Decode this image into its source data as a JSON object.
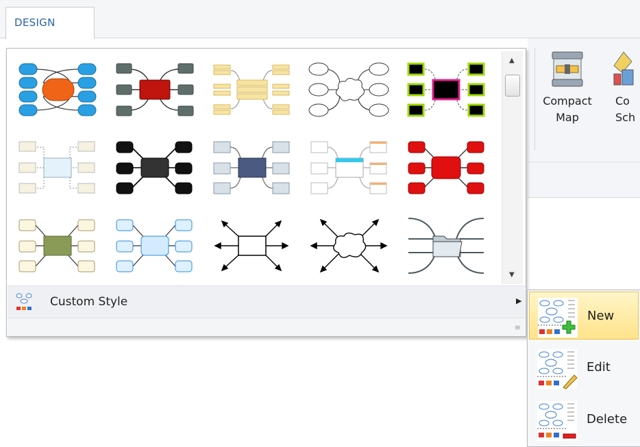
{
  "tabs": [
    {
      "label": "DESIGN"
    }
  ],
  "ribbon": {
    "buttons": [
      {
        "label_line1": "Compact",
        "label_line2": "Map",
        "icon": "compact-map-icon"
      },
      {
        "label_line1": "Co",
        "label_line2": "Sch",
        "icon": "color-scheme-icon"
      }
    ]
  },
  "gallery": {
    "styles": [
      {
        "icon": "style-orange-blue"
      },
      {
        "icon": "style-red-gray"
      },
      {
        "icon": "style-yellow-lines"
      },
      {
        "icon": "style-cloud-ovals"
      },
      {
        "icon": "style-black-green"
      },
      {
        "icon": "style-light-dotted"
      },
      {
        "icon": "style-black"
      },
      {
        "icon": "style-navy-gray"
      },
      {
        "icon": "style-cyan-orange"
      },
      {
        "icon": "style-red"
      },
      {
        "icon": "style-olive-cream"
      },
      {
        "icon": "style-light-blue"
      },
      {
        "icon": "style-box-arrows"
      },
      {
        "icon": "style-cloud-arrows"
      },
      {
        "icon": "style-folder"
      }
    ],
    "custom_style_label": "Custom Style"
  },
  "submenu": {
    "items": [
      {
        "label": "New",
        "selected": true,
        "icon": "new-style-icon"
      },
      {
        "label": "Edit",
        "selected": false,
        "icon": "edit-style-icon"
      },
      {
        "label": "Delete",
        "selected": false,
        "icon": "delete-style-icon"
      }
    ]
  }
}
